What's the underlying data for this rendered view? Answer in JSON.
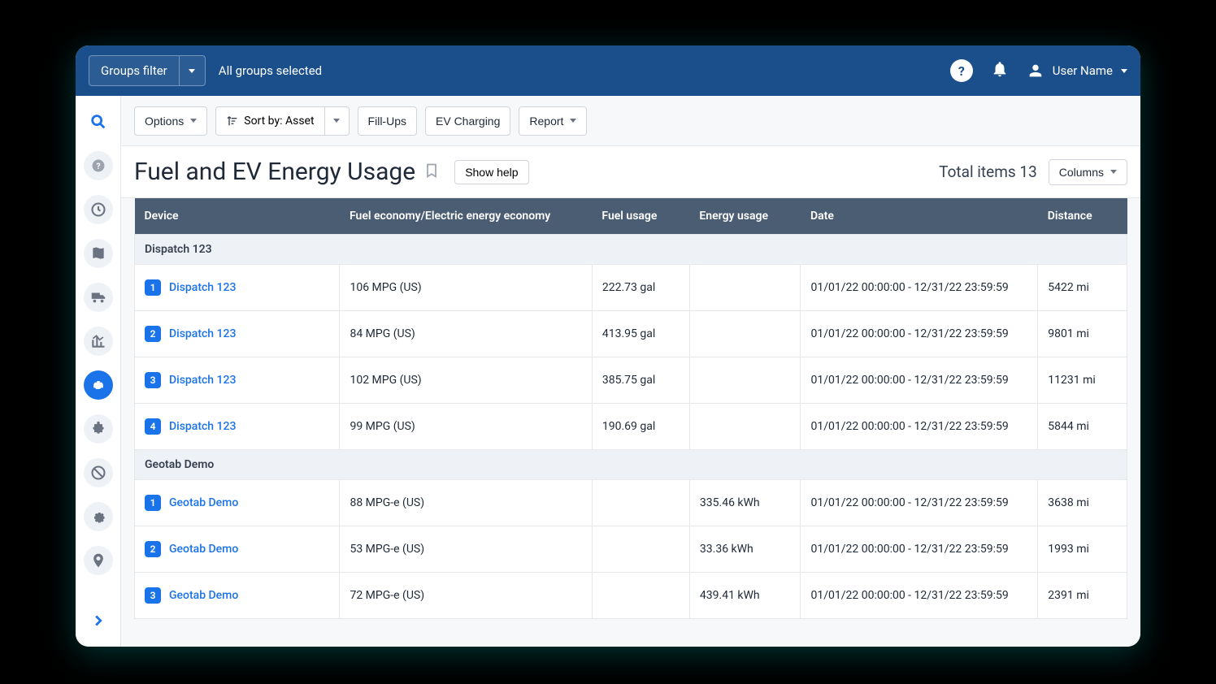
{
  "topbar": {
    "groups_filter_label": "Groups filter",
    "groups_selected": "All groups selected",
    "user_name": "User Name"
  },
  "toolbar": {
    "options": "Options",
    "sort_by": "Sort by: Asset",
    "fill_ups": "Fill-Ups",
    "ev_charging": "EV Charging",
    "report": "Report"
  },
  "page": {
    "title": "Fuel and EV Energy Usage",
    "show_help": "Show help",
    "total_items_label": "Total items 13",
    "columns_btn": "Columns"
  },
  "table": {
    "headers": {
      "device": "Device",
      "economy": "Fuel economy/Electric energy economy",
      "fuel": "Fuel usage",
      "energy": "Energy usage",
      "date": "Date",
      "distance": "Distance"
    },
    "groups": [
      {
        "name": "Dispatch 123",
        "rows": [
          {
            "badge": "1",
            "device": "Dispatch 123",
            "economy": "106 MPG (US)",
            "fuel": "222.73 gal",
            "energy": "",
            "date": "01/01/22 00:00:00 - 12/31/22 23:59:59",
            "distance": "5422 mi"
          },
          {
            "badge": "2",
            "device": "Dispatch 123",
            "economy": "84 MPG (US)",
            "fuel": "413.95 gal",
            "energy": "",
            "date": "01/01/22 00:00:00 - 12/31/22 23:59:59",
            "distance": "9801 mi"
          },
          {
            "badge": "3",
            "device": "Dispatch 123",
            "economy": "102 MPG (US)",
            "fuel": "385.75 gal",
            "energy": "",
            "date": "01/01/22 00:00:00 - 12/31/22 23:59:59",
            "distance": "11231 mi"
          },
          {
            "badge": "4",
            "device": "Dispatch 123",
            "economy": "99 MPG (US)",
            "fuel": "190.69 gal",
            "energy": "",
            "date": "01/01/22 00:00:00 - 12/31/22 23:59:59",
            "distance": "5844 mi"
          }
        ]
      },
      {
        "name": "Geotab Demo",
        "rows": [
          {
            "badge": "1",
            "device": "Geotab Demo",
            "economy": "88 MPG-e (US)",
            "fuel": "",
            "energy": "335.46 kWh",
            "date": "01/01/22 00:00:00 - 12/31/22 23:59:59",
            "distance": "3638 mi"
          },
          {
            "badge": "2",
            "device": "Geotab Demo",
            "economy": "53 MPG-e (US)",
            "fuel": "",
            "energy": "33.36 kWh",
            "date": "01/01/22 00:00:00 - 12/31/22 23:59:59",
            "distance": "1993 mi"
          },
          {
            "badge": "3",
            "device": "Geotab Demo",
            "economy": "72 MPG-e (US)",
            "fuel": "",
            "energy": "439.41 kWh",
            "date": "01/01/22 00:00:00 - 12/31/22 23:59:59",
            "distance": "2391 mi"
          }
        ]
      }
    ]
  }
}
